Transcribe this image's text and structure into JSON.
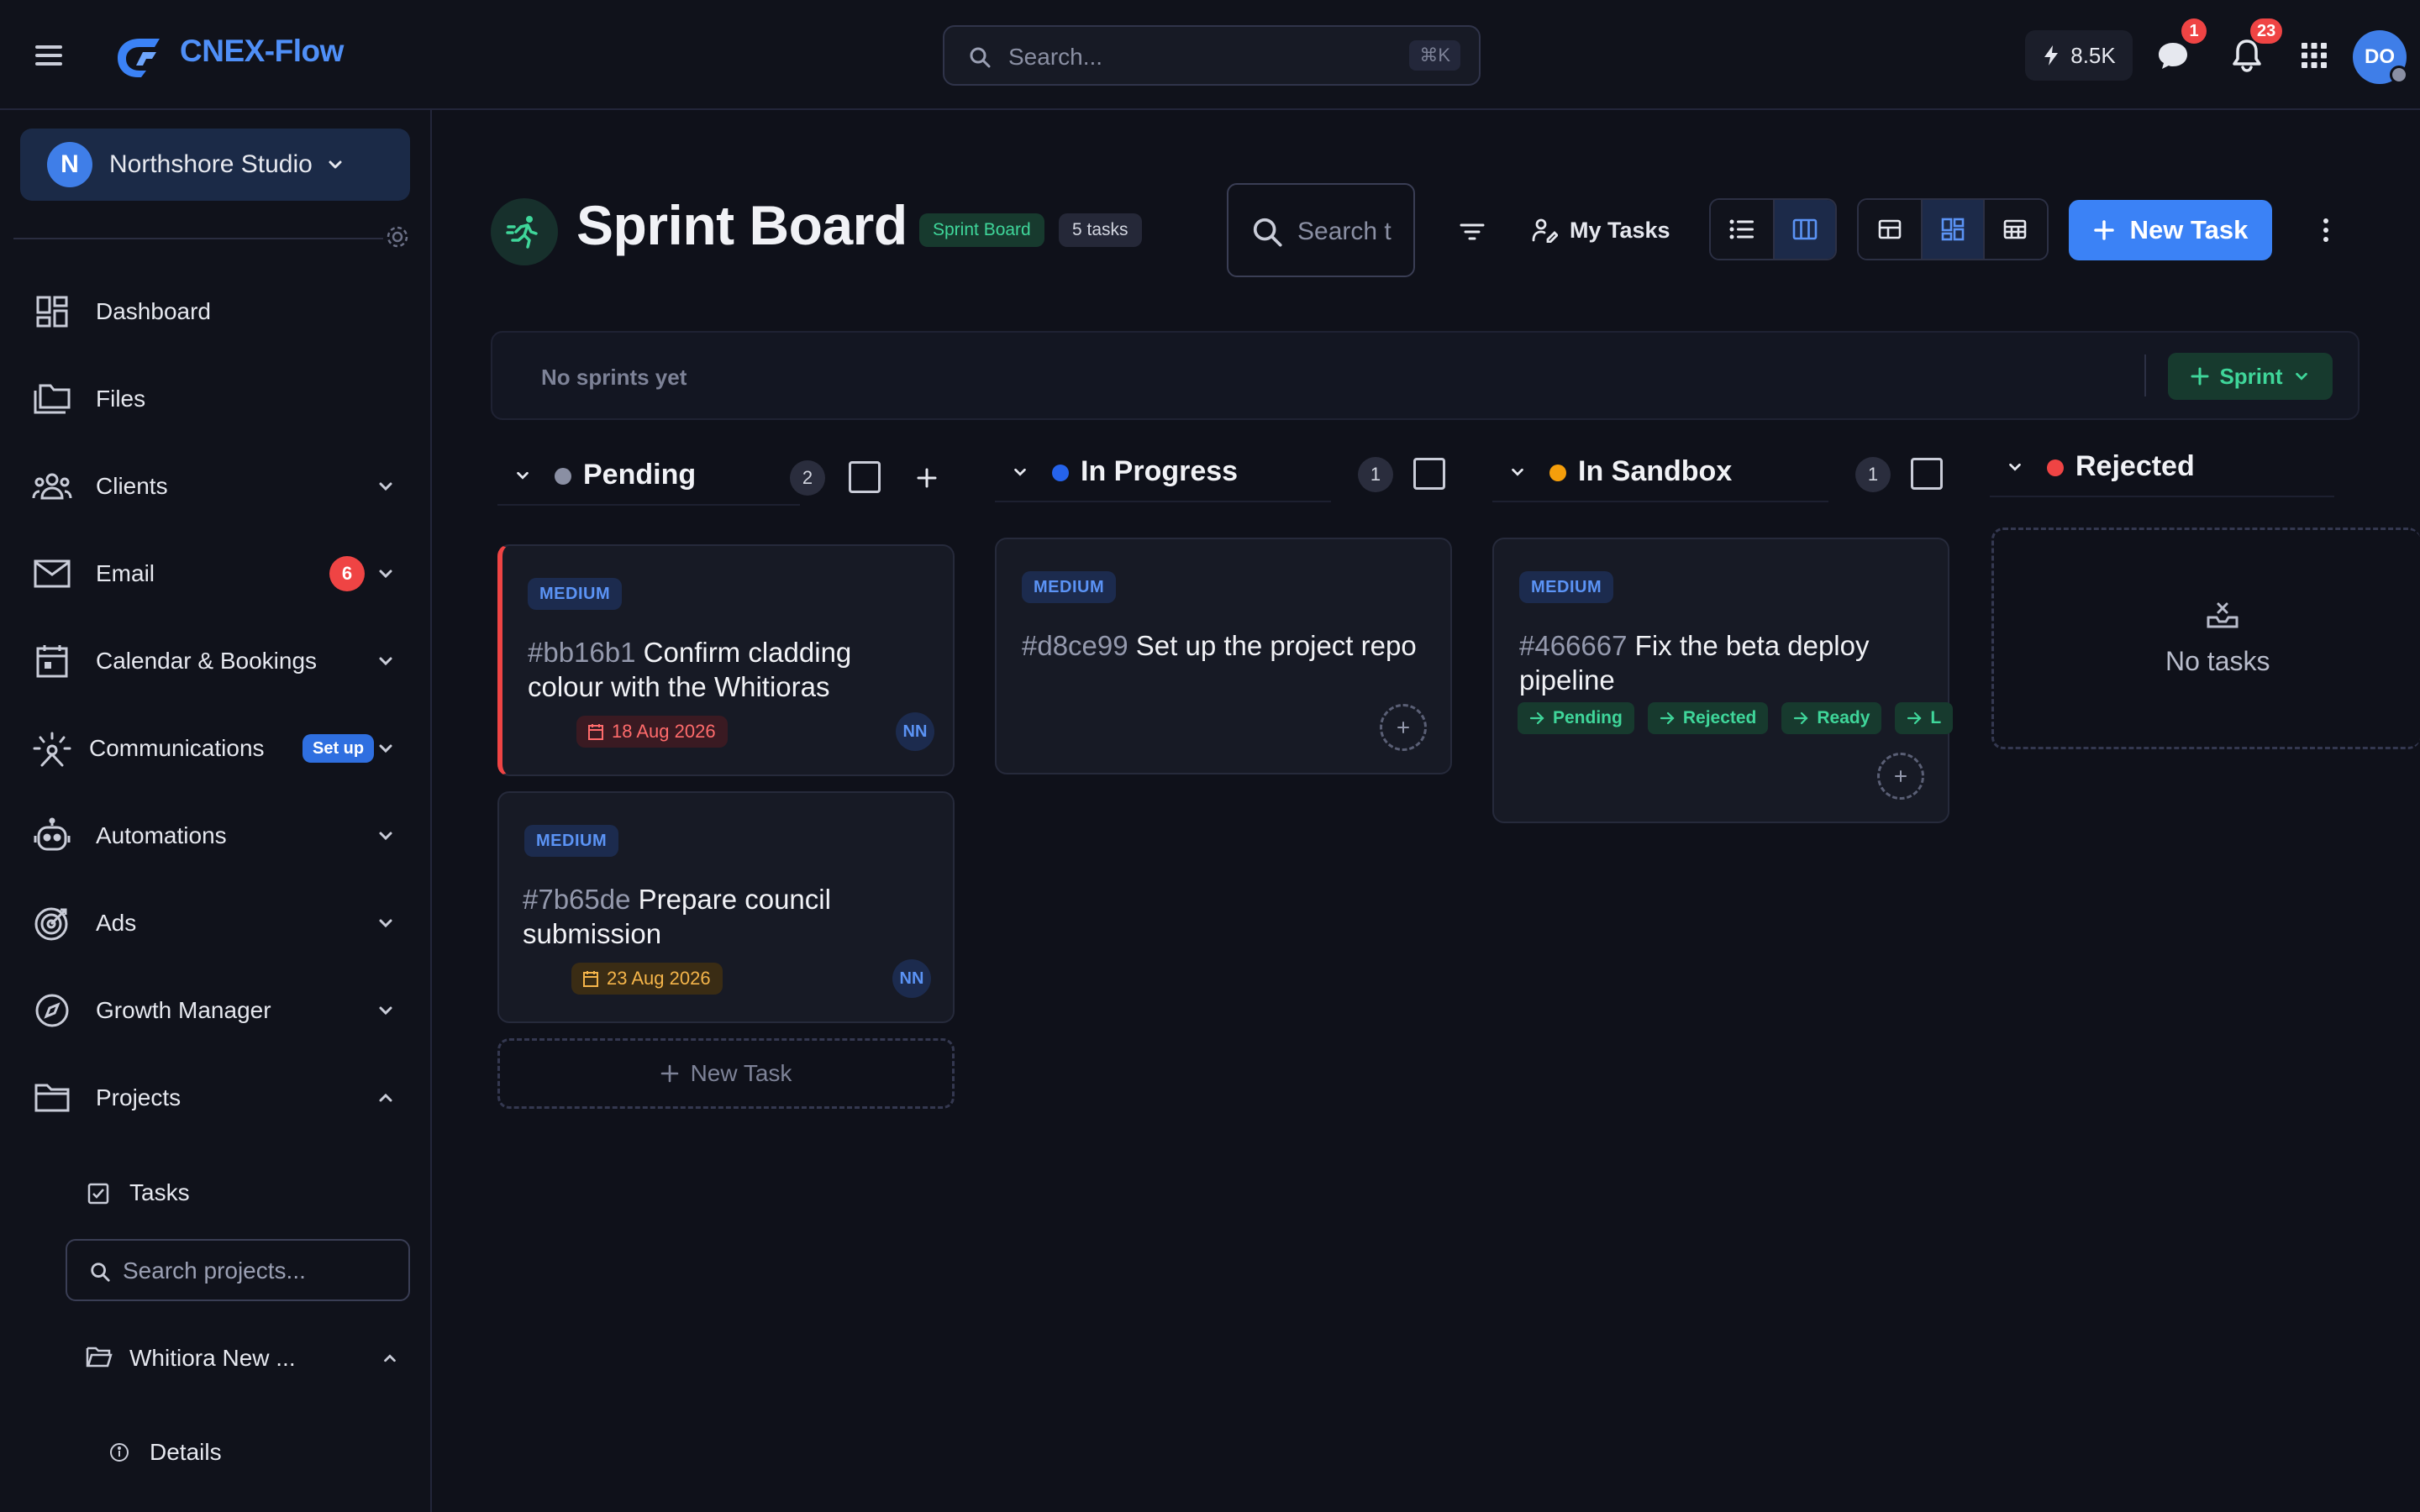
{
  "topbar": {
    "brand": "CNEX-Flow",
    "search_placeholder": "Search...",
    "search_shortcut": "⌘K",
    "credits": "8.5K",
    "chat_badge": "1",
    "notif_badge": "23",
    "user_initials": "DO"
  },
  "sidebar": {
    "workspace_initial": "N",
    "workspace_name": "Northshore Studio",
    "items": [
      {
        "label": "Dashboard"
      },
      {
        "label": "Files"
      },
      {
        "label": "Clients"
      },
      {
        "label": "Email",
        "badge": "6"
      },
      {
        "label": "Calendar & Bookings"
      },
      {
        "label": "Communications",
        "badge": "Set up"
      },
      {
        "label": "Automations"
      },
      {
        "label": "Ads"
      },
      {
        "label": "Growth Manager"
      },
      {
        "label": "Projects"
      }
    ],
    "tasks_label": "Tasks",
    "project_search_placeholder": "Search projects...",
    "project_name": "Whitiora New ...",
    "details_label": "Details"
  },
  "header": {
    "title": "Sprint Board",
    "tag": "Sprint Board",
    "task_count": "5 tasks",
    "search_placeholder": "Search t",
    "my_tasks": "My Tasks",
    "new_task": "New Task"
  },
  "sprint_bar": {
    "empty_text": "No sprints yet",
    "sprint_button": "Sprint"
  },
  "board": {
    "columns": [
      {
        "title": "Pending",
        "count": "2",
        "dot_color": "#8a8fa3"
      },
      {
        "title": "In Progress",
        "count": "1",
        "dot_color": "#2563eb"
      },
      {
        "title": "In Sandbox",
        "count": "1",
        "dot_color": "#f59e0b"
      },
      {
        "title": "Rejected",
        "dot_color": "#ef4444"
      }
    ],
    "cards": [
      {
        "priority": "MEDIUM",
        "id": "#bb16b1",
        "title": "Confirm cladding colour with the Whitioras",
        "due": "18 Aug 2026",
        "assignee": "NN"
      },
      {
        "priority": "MEDIUM",
        "id": "#7b65de",
        "title": "Prepare council submission",
        "due": "23 Aug 2026",
        "assignee": "NN"
      },
      {
        "priority": "MEDIUM",
        "id": "#d8ce99",
        "title": "Set up the project repo"
      },
      {
        "priority": "MEDIUM",
        "id": "#466667",
        "title": "Fix the beta deploy pipeline",
        "transitions": [
          "Pending",
          "Rejected",
          "Ready",
          "L"
        ]
      }
    ],
    "new_task_label": "New Task",
    "empty_label": "No tasks"
  },
  "colors": {
    "accent": "#3b82f6",
    "green": "#3fd69a",
    "danger": "#ef4444",
    "background": "#0f111a"
  },
  "icons": [
    "menu-icon",
    "search-icon",
    "bolt-icon",
    "chat-icon",
    "bell-icon",
    "apps-grid-icon",
    "chevron-down-icon",
    "gear-icon",
    "runner-icon",
    "filter-icon",
    "user-edit-icon",
    "list-view-icon",
    "board-view-icon",
    "plus-icon",
    "more-vert-icon",
    "calendar-icon",
    "arrow-right-icon",
    "inbox-empty-icon"
  ]
}
